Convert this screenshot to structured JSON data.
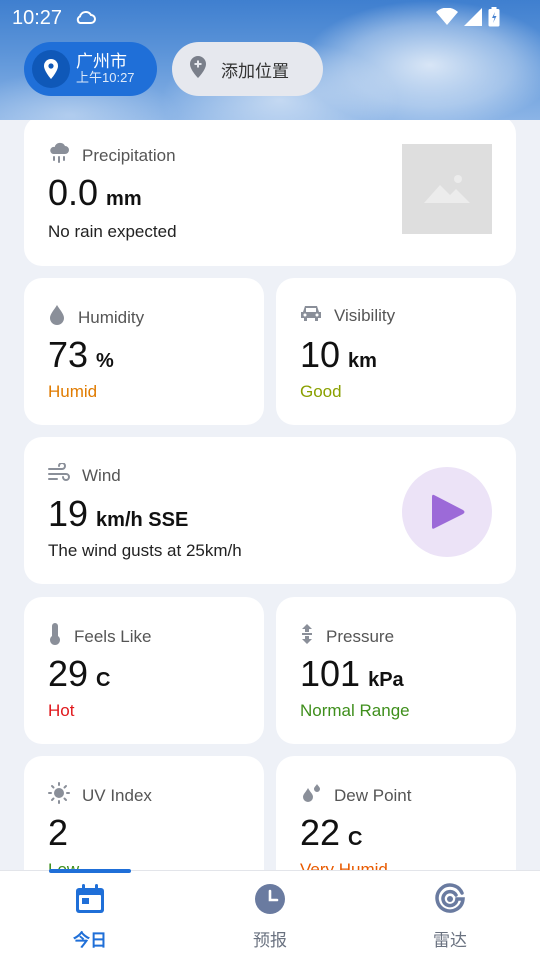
{
  "status_bar": {
    "time": "10:27"
  },
  "location": {
    "city": "广州市",
    "time_label": "上午10:27"
  },
  "add_location": {
    "label": "添加位置"
  },
  "cards": {
    "precipitation": {
      "title": "Precipitation",
      "value": "0.0",
      "unit": "mm",
      "description": "No rain expected"
    },
    "humidity": {
      "title": "Humidity",
      "value": "73",
      "unit": "%",
      "description": "Humid",
      "description_color": "#e07b00"
    },
    "visibility": {
      "title": "Visibility",
      "value": "10",
      "unit": "km",
      "description": "Good",
      "description_color": "#8aa000"
    },
    "wind": {
      "title": "Wind",
      "value": "19",
      "unit": "km/h SSE",
      "description": "The wind gusts at 25km/h"
    },
    "feels_like": {
      "title": "Feels Like",
      "value": "29",
      "unit": "C",
      "description": "Hot",
      "description_color": "#e0181d"
    },
    "pressure": {
      "title": "Pressure",
      "value": "101",
      "unit": "kPa",
      "description": "Normal Range",
      "description_color": "#3f8f1c"
    },
    "uv_index": {
      "title": "UV Index",
      "value": "2",
      "unit": "",
      "description": "Low",
      "description_color": "#3f8f1c"
    },
    "dew_point": {
      "title": "Dew Point",
      "value": "22",
      "unit": "C",
      "description": "Very Humid",
      "description_color": "#e85a00"
    }
  },
  "bottom_nav": {
    "today": "今日",
    "forecast": "预报",
    "radar": "雷达"
  },
  "colors": {
    "accent": "#1f6fd8",
    "background": "#eef1f7"
  }
}
